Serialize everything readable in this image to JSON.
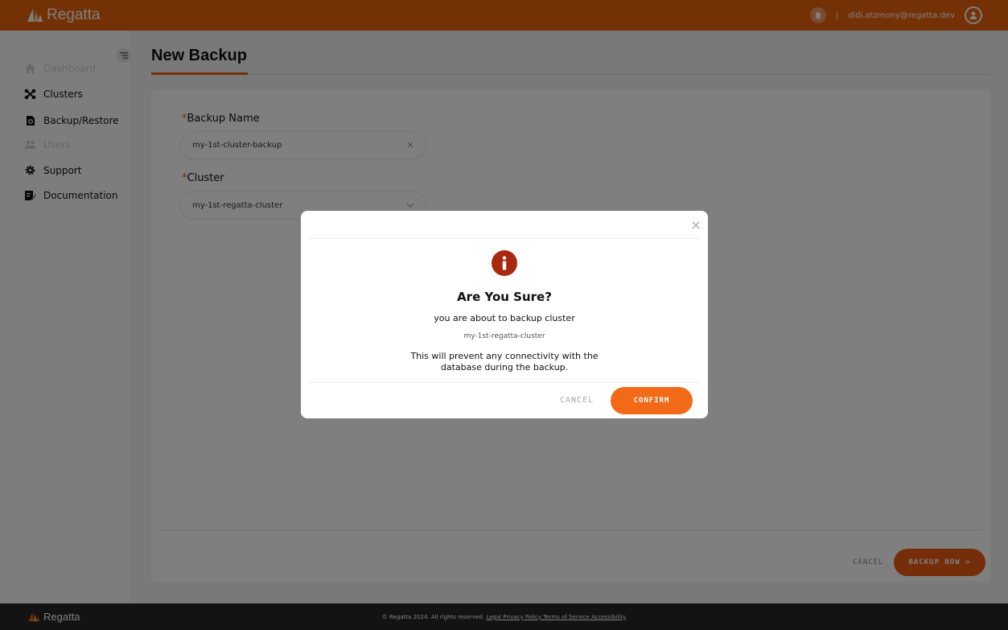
{
  "header": {
    "brand": "Regatta",
    "separator": "|",
    "user_email": "didi.atzmony@regatta.dev"
  },
  "sidebar": {
    "items": [
      {
        "label": "Dashboard",
        "enabled": false
      },
      {
        "label": "Clusters",
        "enabled": true
      },
      {
        "label": "Backup/Restore",
        "enabled": true
      },
      {
        "label": "Users",
        "enabled": false
      },
      {
        "label": "Support",
        "enabled": true
      },
      {
        "label": "Documentation",
        "enabled": true
      }
    ]
  },
  "main": {
    "title": "New Backup",
    "form": {
      "required_mark": "*",
      "backup_name_label": "Backup Name",
      "backup_name_value": "my-1st-cluster-backup",
      "cluster_label": "Cluster",
      "cluster_value": "my-1st-regatta-cluster"
    },
    "cancel_label": "CANCEL",
    "backup_now_label": "BACKUP NOW >"
  },
  "modal": {
    "title": "Are You Sure?",
    "line1": "you are about to backup cluster",
    "cluster_name": "my-1st-regatta-cluster",
    "warning": "This will prevent any connectivity with the database during the backup.",
    "cancel_label": "CANCEL",
    "confirm_label": "CONFIRM"
  },
  "footer": {
    "brand": "Regatta",
    "copyright": "© Regatta 2024. All rights reserved.",
    "link1": "Legal Privacy Policy",
    "link2": ",Terms of Service Accessibility"
  },
  "colors": {
    "accent": "#e8620c",
    "footer_bg": "#262626",
    "modal_icon": "#a8290f"
  }
}
